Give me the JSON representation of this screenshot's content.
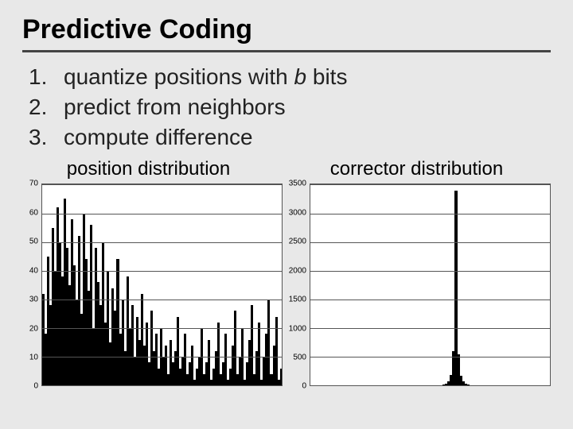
{
  "title": "Predictive Coding",
  "list": [
    {
      "num": "1.",
      "text_pre": "quantize positions with ",
      "var": "b",
      "text_post": " bits"
    },
    {
      "num": "2.",
      "text_pre": "predict from neighbors",
      "var": "",
      "text_post": ""
    },
    {
      "num": "3.",
      "text_pre": "compute difference",
      "var": "",
      "text_post": ""
    }
  ],
  "chart_data": [
    {
      "type": "bar",
      "title": "position distribution",
      "ylabel": "",
      "xlabel": "",
      "ylim": [
        0,
        70
      ],
      "yticks": [
        0,
        10,
        20,
        30,
        40,
        50,
        60,
        70
      ],
      "values": [
        32,
        18,
        45,
        28,
        55,
        40,
        62,
        50,
        38,
        65,
        48,
        35,
        58,
        42,
        30,
        52,
        25,
        60,
        44,
        33,
        56,
        20,
        48,
        36,
        28,
        50,
        22,
        40,
        15,
        34,
        26,
        44,
        18,
        30,
        12,
        38,
        20,
        28,
        10,
        24,
        16,
        32,
        14,
        22,
        8,
        26,
        12,
        18,
        6,
        20,
        10,
        14,
        4,
        16,
        8,
        12,
        24,
        6,
        10,
        18,
        4,
        8,
        14,
        2,
        6,
        10,
        20,
        4,
        8,
        16,
        2,
        6,
        12,
        22,
        4,
        8,
        18,
        2,
        6,
        14,
        26,
        4,
        10,
        20,
        2,
        8,
        16,
        28,
        4,
        12,
        22,
        2,
        10,
        18,
        30,
        4,
        14,
        24,
        2,
        6
      ]
    },
    {
      "type": "bar",
      "title": "corrector distribution",
      "ylabel": "",
      "xlabel": "",
      "ylim": [
        0,
        3500
      ],
      "yticks": [
        0,
        500,
        1000,
        1500,
        2000,
        2500,
        3000,
        3500
      ],
      "center_index": 60,
      "n_bins": 100,
      "values_sparse": {
        "55": 20,
        "56": 40,
        "57": 80,
        "58": 180,
        "59": 600,
        "60": 3400,
        "61": 550,
        "62": 170,
        "63": 75,
        "64": 38,
        "65": 18
      }
    }
  ]
}
